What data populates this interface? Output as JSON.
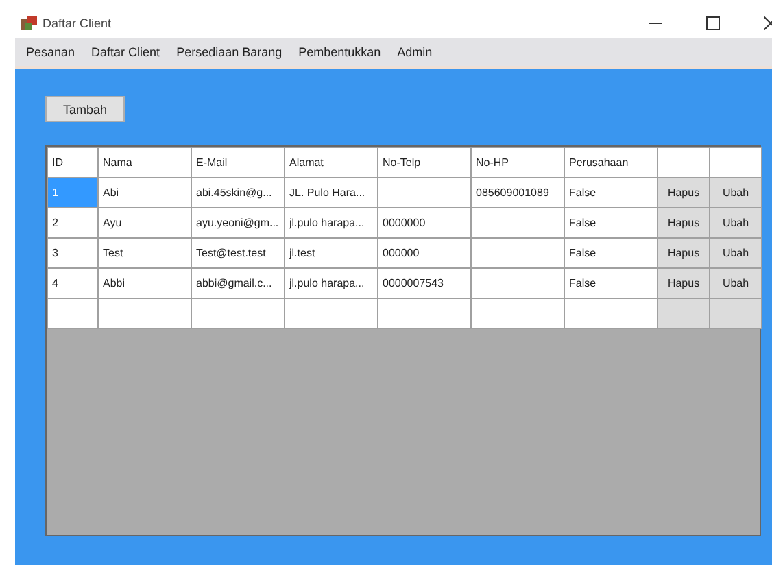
{
  "window": {
    "title": "Daftar Client"
  },
  "menu": [
    "Pesanan",
    "Daftar Client",
    "Persediaan Barang",
    "Pembentukkan",
    "Admin"
  ],
  "add_button": "Tambah",
  "table": {
    "columns": [
      "ID",
      "Nama",
      "E-Mail",
      "Alamat",
      "No-Telp",
      "No-HP",
      "Perusahaan"
    ],
    "rows": [
      {
        "cells": [
          "1",
          "Abi",
          "abi.45skin@g...",
          "JL. Pulo Hara...",
          "",
          "085609001089",
          "False"
        ],
        "delete": "Hapus",
        "edit": "Ubah",
        "selected": true
      },
      {
        "cells": [
          "2",
          "Ayu",
          "ayu.yeoni@gm...",
          "jl.pulo harapa...",
          "0000000",
          "",
          "False"
        ],
        "delete": "Hapus",
        "edit": "Ubah",
        "selected": false
      },
      {
        "cells": [
          "3",
          "Test",
          "Test@test.test",
          "jl.test",
          "000000",
          "",
          "False"
        ],
        "delete": "Hapus",
        "edit": "Ubah",
        "selected": false
      },
      {
        "cells": [
          "4",
          "Abbi",
          "abbi@gmail.c...",
          "jl.pulo harapa...",
          "0000007543",
          "",
          "False"
        ],
        "delete": "Hapus",
        "edit": "Ubah",
        "selected": false
      }
    ]
  }
}
